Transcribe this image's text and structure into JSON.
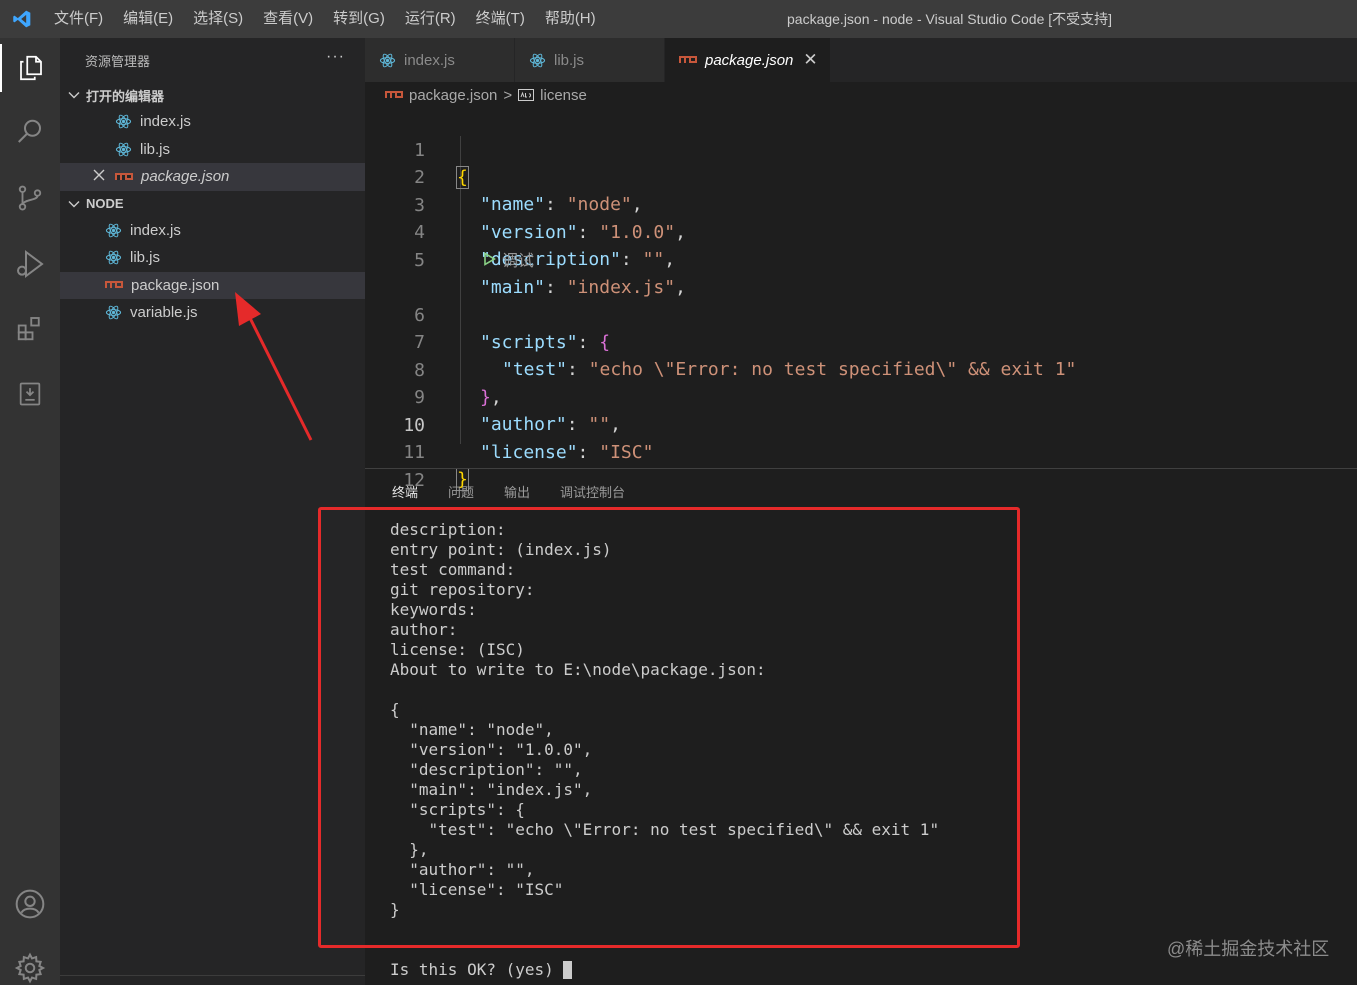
{
  "titlebar": {
    "menus": [
      "文件(F)",
      "编辑(E)",
      "选择(S)",
      "查看(V)",
      "转到(G)",
      "运行(R)",
      "终端(T)",
      "帮助(H)"
    ],
    "title": "package.json - node - Visual Studio Code [不受支持]"
  },
  "activitybar": {
    "icons": [
      "explorer-icon",
      "search-icon",
      "source-control-icon",
      "run-debug-icon",
      "extensions-icon",
      "remote-icon",
      "account-icon",
      "settings-gear-icon"
    ]
  },
  "sidebar": {
    "header": "资源管理器",
    "more": "···",
    "open_editors_section": "打开的编辑器",
    "open_editors": [
      {
        "label": "index.js"
      },
      {
        "label": "lib.js"
      },
      {
        "label": "package.json"
      }
    ],
    "folder_section": "NODE",
    "files": [
      {
        "label": "index.js"
      },
      {
        "label": "lib.js"
      },
      {
        "label": "package.json"
      },
      {
        "label": "variable.js"
      }
    ]
  },
  "tabs": [
    {
      "label": "index.js"
    },
    {
      "label": "lib.js"
    },
    {
      "label": "package.json",
      "close": "✕"
    }
  ],
  "breadcrumb": {
    "file": "package.json",
    "sep": ">",
    "symbol": "license"
  },
  "editor": {
    "line_numbers": [
      "1",
      "2",
      "3",
      "4",
      "5",
      "6",
      "7",
      "8",
      "9",
      "10",
      "11",
      "12"
    ],
    "current_line": "10",
    "codelens": "调试",
    "lines": {
      "l1": "{",
      "l2k": "\"name\"",
      "l2v": "\"node\"",
      "l3k": "\"version\"",
      "l3v": "\"1.0.0\"",
      "l4k": "\"description\"",
      "l4v": "\"\"",
      "l5k": "\"main\"",
      "l5v": "\"index.js\"",
      "l6k": "\"scripts\"",
      "l6b": "{",
      "l7k": "\"test\"",
      "l7v": "\"echo \\\"Error: no test specified\\\" && exit 1\"",
      "l8b": "}",
      "l9k": "\"author\"",
      "l9v": "\"\"",
      "l10k": "\"license\"",
      "l10v": "\"ISC\"",
      "l11": "}"
    }
  },
  "panel": {
    "tabs": [
      "终端",
      "问题",
      "输出",
      "调试控制台"
    ],
    "terminal_text": "description:\nentry point: (index.js)\ntest command:\ngit repository:\nkeywords:\nauthor:\nlicense: (ISC)\nAbout to write to E:\\node\\package.json:\n\n{\n  \"name\": \"node\",\n  \"version\": \"1.0.0\",\n  \"description\": \"\",\n  \"main\": \"index.js\",\n  \"scripts\": {\n    \"test\": \"echo \\\"Error: no test specified\\\" && exit 1\"\n  },\n  \"author\": \"\",\n  \"license\": \"ISC\"\n}",
    "prompt": "Is this OK? (yes) "
  },
  "watermark": "@稀土掘金技术社区",
  "colors": {
    "annotation_red": "#e52a2a",
    "react_icon": "#5fb8d9",
    "json_icon": "#c7573b"
  }
}
